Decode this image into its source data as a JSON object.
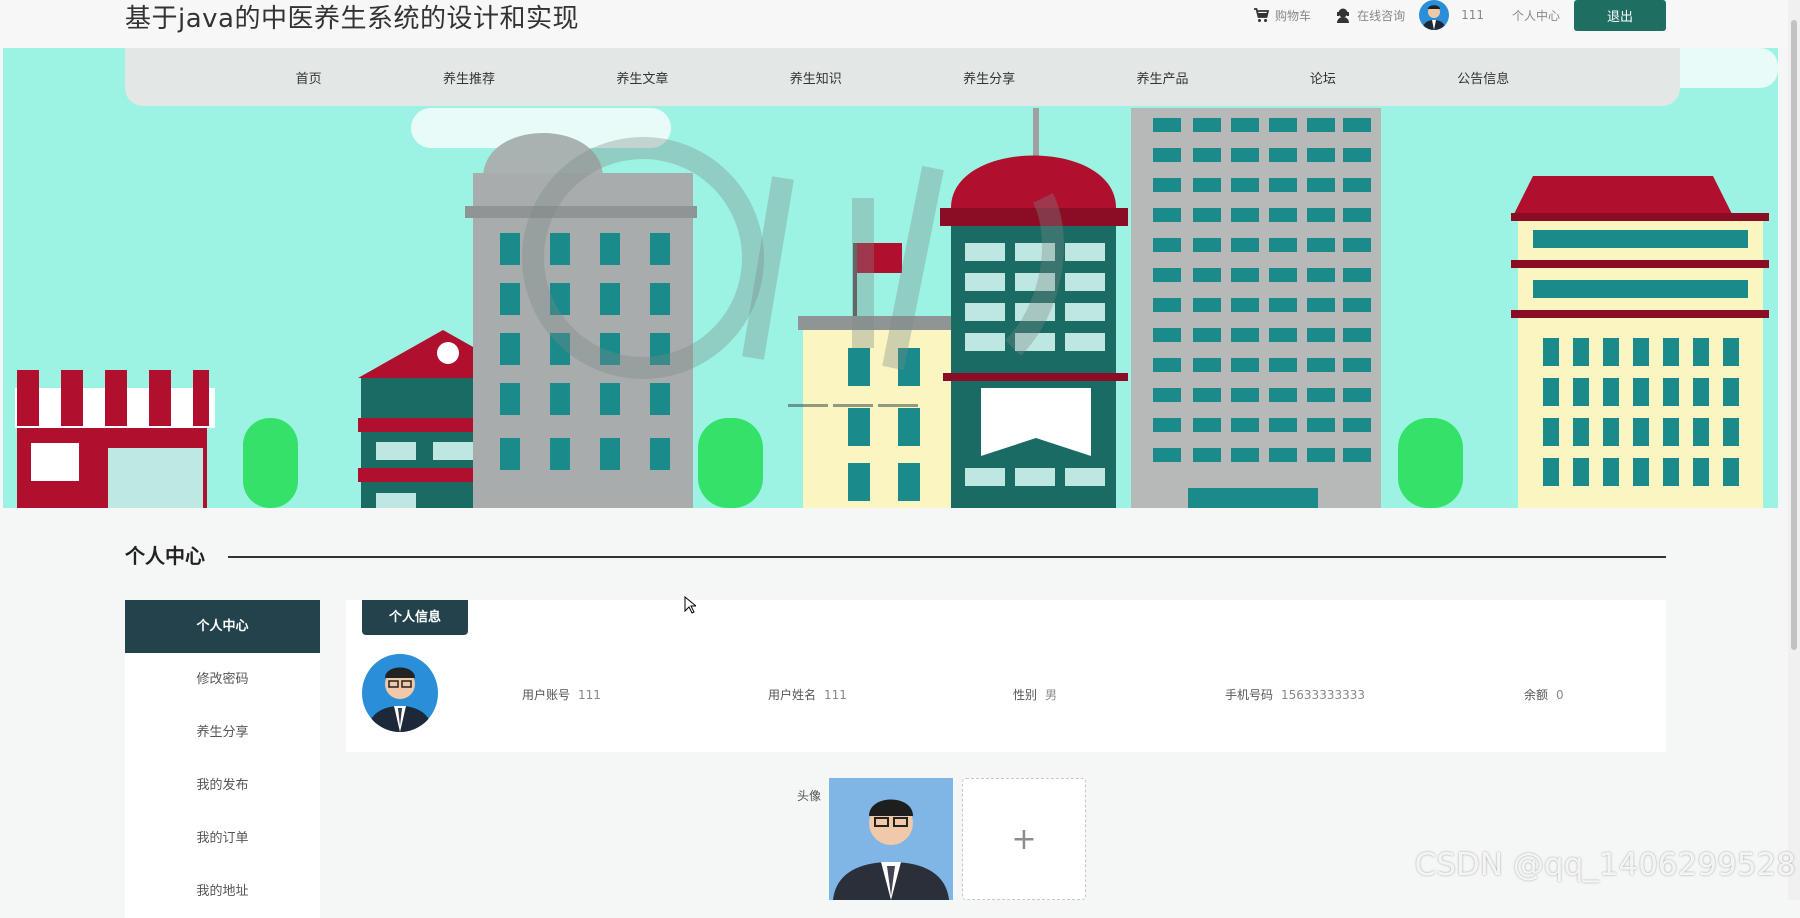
{
  "header": {
    "title": "基于java的中医养生系统的设计和实现",
    "cart_label": "购物车",
    "consult_label": "在线咨询",
    "username": "111",
    "user_center_label": "个人中心",
    "logout_label": "退出"
  },
  "nav": {
    "items": [
      "首页",
      "养生推荐",
      "养生文章",
      "养生知识",
      "养生分享",
      "养生产品",
      "论坛",
      "公告信息"
    ]
  },
  "section": {
    "title": "个人中心"
  },
  "sidebar": {
    "items": [
      "个人中心",
      "修改密码",
      "养生分享",
      "我的发布",
      "我的订单",
      "我的地址"
    ],
    "active_index": 0
  },
  "profile": {
    "tab_label": "个人信息",
    "fields": [
      {
        "label": "用户账号",
        "value": "111"
      },
      {
        "label": "用户姓名",
        "value": "111"
      },
      {
        "label": "性别",
        "value": "男"
      },
      {
        "label": "手机号码",
        "value": "15633333333"
      },
      {
        "label": "余额",
        "value": "0"
      }
    ]
  },
  "upload": {
    "label": "头像",
    "add_symbol": "+"
  },
  "watermark": "CSDN @qq_1406299528",
  "colors": {
    "accent": "#1f6e62",
    "sidebar_active": "#24424c",
    "banner_sky": "#9cf3e3"
  }
}
